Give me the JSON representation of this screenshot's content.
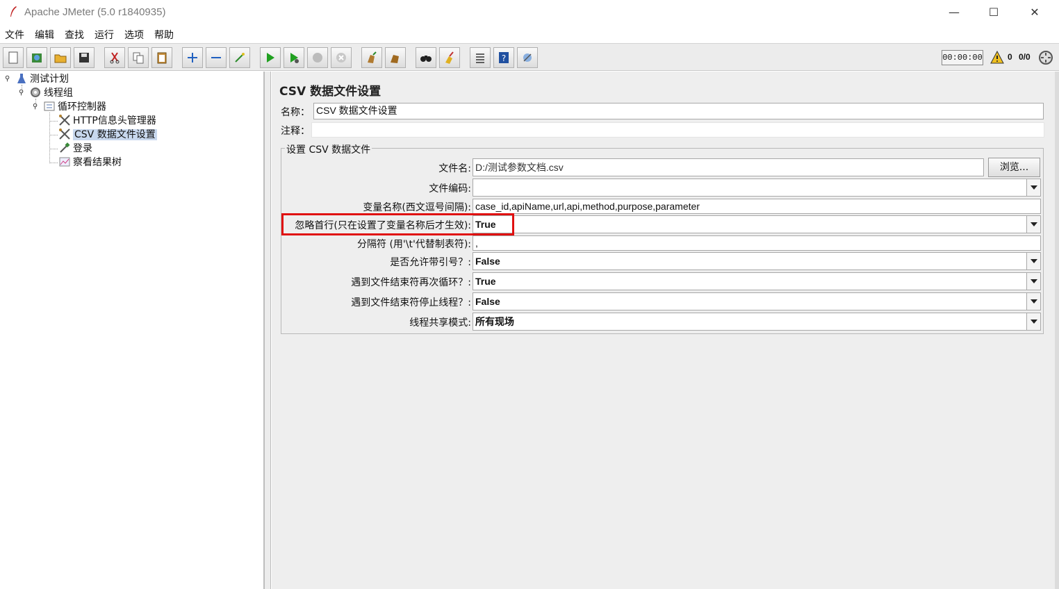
{
  "window": {
    "title": "Apache JMeter (5.0 r1840935)",
    "minimize": "—",
    "maximize": "☐",
    "close": "✕"
  },
  "menu": [
    "文件",
    "编辑",
    "查找",
    "运行",
    "选项",
    "帮助"
  ],
  "toolbar": {
    "timer": "00:00:00",
    "warning_count": "0",
    "thread_count": "0/0"
  },
  "tree": {
    "items": [
      {
        "label": "测试计划"
      },
      {
        "label": "线程组"
      },
      {
        "label": "循环控制器"
      },
      {
        "label": "HTTP信息头管理器"
      },
      {
        "label": "CSV 数据文件设置"
      },
      {
        "label": "登录"
      },
      {
        "label": "察看结果树"
      }
    ]
  },
  "panel": {
    "title": "CSV 数据文件设置",
    "name_label": "名称：",
    "name_value": "CSV 数据文件设置",
    "comment_label": "注释：",
    "comment_value": "",
    "fieldset_legend": "设置 CSV 数据文件",
    "filename_label": "文件名:",
    "filename_value": "D:/测试参数文档.csv",
    "browse_label": "浏览...",
    "encoding_label": "文件编码:",
    "encoding_value": "",
    "varnames_label": "变量名称(西文逗号间隔):",
    "varnames_value": "case_id,apiName,url,api,method,purpose,parameter",
    "ignore_first_label": "忽略首行(只在设置了变量名称后才生效):",
    "ignore_first_value": "True",
    "delimiter_label": "分隔符 (用'\\t'代替制表符):",
    "delimiter_value": ",",
    "allow_quoted_label": "是否允许带引号？:",
    "allow_quoted_value": "False",
    "recycle_label": "遇到文件结束符再次循环？:",
    "recycle_value": "True",
    "stop_thread_label": "遇到文件结束符停止线程？:",
    "stop_thread_value": "False",
    "share_mode_label": "线程共享模式:",
    "share_mode_value": "所有现场"
  },
  "colors": {
    "highlight": "#e01010",
    "selection": "#c8d8ee"
  }
}
